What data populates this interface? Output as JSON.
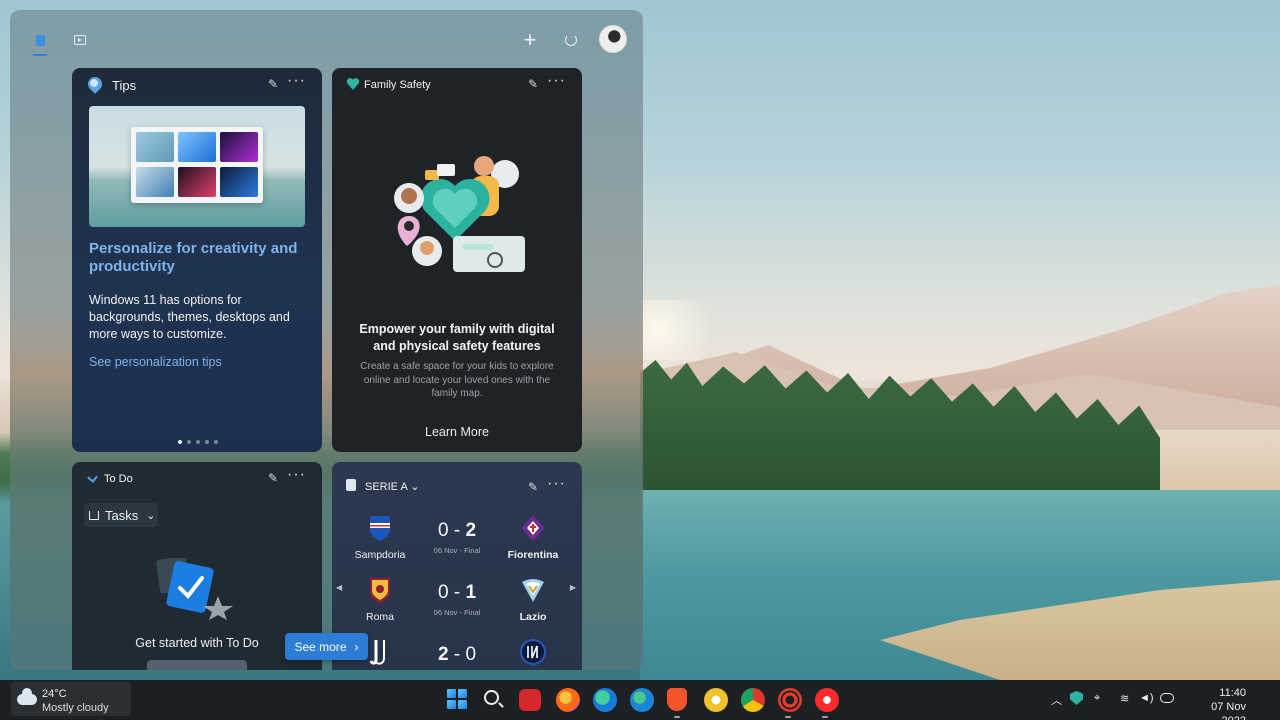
{
  "toolbar": {
    "home_icon": "home-icon",
    "video_icon": "video-icon",
    "add_icon": "+",
    "refresh_icon": "refresh-icon"
  },
  "tips": {
    "title": "Tips",
    "headline": "Personalize for creativity and productivity",
    "body": "Windows 11 has options for backgrounds, themes, desktops and more ways to customize.",
    "link": "See personalization tips",
    "page_count": 5,
    "active_page": 1
  },
  "family": {
    "title": "Family Safety",
    "headline": "Empower your family with digital and physical safety features",
    "description": "Create a safe space for your kids to explore online and locate your loved ones with the family map.",
    "link": "Learn More"
  },
  "todo": {
    "title": "To Do",
    "list_button": "Tasks",
    "empty_text": "Get started with To Do"
  },
  "serie": {
    "title": "SERIE A",
    "matches": [
      {
        "home": "Sampdoria",
        "home_score": "0",
        "away_score": "2",
        "away": "Fiorentina",
        "meta": "06 Nov - Final",
        "winner": "away"
      },
      {
        "home": "Roma",
        "home_score": "0",
        "away_score": "1",
        "away": "Lazio",
        "meta": "06 Nov - Final",
        "winner": "away"
      },
      {
        "home": "",
        "home_score": "2",
        "away_score": "0",
        "away": "",
        "meta": "",
        "winner": "home"
      }
    ]
  },
  "see_more": {
    "label": "See more",
    "chevron": "›"
  },
  "taskbar": {
    "weather": {
      "temp": "24°C",
      "condition": "Mostly cloudy"
    },
    "time": "11:40",
    "date": "07 Nov 2022"
  },
  "colors": {
    "accent": "#2d7cd6",
    "link": "#7fb3ec",
    "card_dark": "#1f2327"
  }
}
